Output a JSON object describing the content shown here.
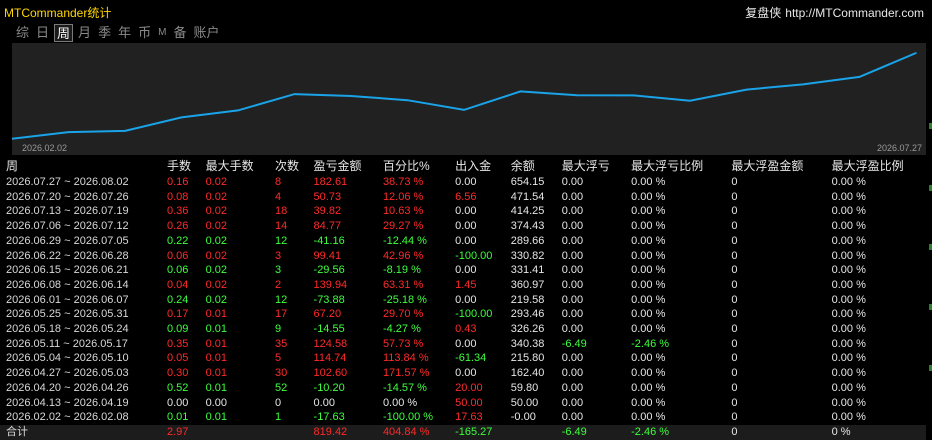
{
  "header": {
    "title": "MTCommander统计",
    "brand": "复盘侠",
    "url": "http://MTCommander.com"
  },
  "tabs": [
    "综",
    "日",
    "周",
    "月",
    "季",
    "年",
    "币",
    "M",
    "备",
    "账户"
  ],
  "active_tab": "周",
  "chart": {
    "start_date": "2026.02.02",
    "end_date": "2026.07.27",
    "line_color": "#1aa3e8"
  },
  "table": {
    "headers": [
      "周",
      "手数",
      "最大手数",
      "次数",
      "盈亏金额",
      "百分比%",
      "出入金",
      "余额",
      "最大浮亏",
      "最大浮亏比例",
      "最大浮盈金额",
      "最大浮盈比例"
    ],
    "rows": [
      {
        "week": "2026.07.27 ~ 2026.08.02",
        "lots": "0.16",
        "max_lots": "0.02",
        "count": "8",
        "pnl": "182.61",
        "pct": "38.73 %",
        "flow": "0.00",
        "balance": "654.15",
        "max_fl": "0.00",
        "max_fl_pct": "0.00 %",
        "max_fp": "0",
        "max_fp_pct": "0.00 %",
        "tone": "red"
      },
      {
        "week": "2026.07.20 ~ 2026.07.26",
        "lots": "0.08",
        "max_lots": "0.02",
        "count": "4",
        "pnl": "50.73",
        "pct": "12.06 %",
        "flow": "6.56",
        "balance": "471.54",
        "max_fl": "0.00",
        "max_fl_pct": "0.00 %",
        "max_fp": "0",
        "max_fp_pct": "0.00 %",
        "tone": "red"
      },
      {
        "week": "2026.07.13 ~ 2026.07.19",
        "lots": "0.36",
        "max_lots": "0.02",
        "count": "18",
        "pnl": "39.82",
        "pct": "10.63 %",
        "flow": "0.00",
        "balance": "414.25",
        "max_fl": "0.00",
        "max_fl_pct": "0.00 %",
        "max_fp": "0",
        "max_fp_pct": "0.00 %",
        "tone": "red"
      },
      {
        "week": "2026.07.06 ~ 2026.07.12",
        "lots": "0.26",
        "max_lots": "0.02",
        "count": "14",
        "pnl": "84.77",
        "pct": "29.27 %",
        "flow": "0.00",
        "balance": "374.43",
        "max_fl": "0.00",
        "max_fl_pct": "0.00 %",
        "max_fp": "0",
        "max_fp_pct": "0.00 %",
        "tone": "red"
      },
      {
        "week": "2026.06.29 ~ 2026.07.05",
        "lots": "0.22",
        "max_lots": "0.02",
        "count": "12",
        "pnl": "-41.16",
        "pct": "-12.44 %",
        "flow": "0.00",
        "balance": "289.66",
        "max_fl": "0.00",
        "max_fl_pct": "0.00 %",
        "max_fp": "0",
        "max_fp_pct": "0.00 %",
        "tone": "green"
      },
      {
        "week": "2026.06.22 ~ 2026.06.28",
        "lots": "0.06",
        "max_lots": "0.02",
        "count": "3",
        "pnl": "99.41",
        "pct": "42.96 %",
        "flow": "-100.00",
        "balance": "330.82",
        "max_fl": "0.00",
        "max_fl_pct": "0.00 %",
        "max_fp": "0",
        "max_fp_pct": "0.00 %",
        "tone": "red"
      },
      {
        "week": "2026.06.15 ~ 2026.06.21",
        "lots": "0.06",
        "max_lots": "0.02",
        "count": "3",
        "pnl": "-29.56",
        "pct": "-8.19 %",
        "flow": "0.00",
        "balance": "331.41",
        "max_fl": "0.00",
        "max_fl_pct": "0.00 %",
        "max_fp": "0",
        "max_fp_pct": "0.00 %",
        "tone": "green"
      },
      {
        "week": "2026.06.08 ~ 2026.06.14",
        "lots": "0.04",
        "max_lots": "0.02",
        "count": "2",
        "pnl": "139.94",
        "pct": "63.31 %",
        "flow": "1.45",
        "balance": "360.97",
        "max_fl": "0.00",
        "max_fl_pct": "0.00 %",
        "max_fp": "0",
        "max_fp_pct": "0.00 %",
        "tone": "red"
      },
      {
        "week": "2026.06.01 ~ 2026.06.07",
        "lots": "0.24",
        "max_lots": "0.02",
        "count": "12",
        "pnl": "-73.88",
        "pct": "-25.18 %",
        "flow": "0.00",
        "balance": "219.58",
        "max_fl": "0.00",
        "max_fl_pct": "0.00 %",
        "max_fp": "0",
        "max_fp_pct": "0.00 %",
        "tone": "green"
      },
      {
        "week": "2026.05.25 ~ 2026.05.31",
        "lots": "0.17",
        "max_lots": "0.01",
        "count": "17",
        "pnl": "67.20",
        "pct": "29.70 %",
        "flow": "-100.00",
        "balance": "293.46",
        "max_fl": "0.00",
        "max_fl_pct": "0.00 %",
        "max_fp": "0",
        "max_fp_pct": "0.00 %",
        "tone": "red"
      },
      {
        "week": "2026.05.18 ~ 2026.05.24",
        "lots": "0.09",
        "max_lots": "0.01",
        "count": "9",
        "pnl": "-14.55",
        "pct": "-4.27 %",
        "flow": "0.43",
        "balance": "326.26",
        "max_fl": "0.00",
        "max_fl_pct": "0.00 %",
        "max_fp": "0",
        "max_fp_pct": "0.00 %",
        "tone": "green"
      },
      {
        "week": "2026.05.11 ~ 2026.05.17",
        "lots": "0.35",
        "max_lots": "0.01",
        "count": "35",
        "pnl": "124.58",
        "pct": "57.73 %",
        "flow": "0.00",
        "balance": "340.38",
        "max_fl": "-6.49",
        "max_fl_pct": "-2.46 %",
        "max_fp": "0",
        "max_fp_pct": "0.00 %",
        "tone": "red"
      },
      {
        "week": "2026.05.04 ~ 2026.05.10",
        "lots": "0.05",
        "max_lots": "0.01",
        "count": "5",
        "pnl": "114.74",
        "pct": "113.84 %",
        "flow": "-61.34",
        "balance": "215.80",
        "max_fl": "0.00",
        "max_fl_pct": "0.00 %",
        "max_fp": "0",
        "max_fp_pct": "0.00 %",
        "tone": "red"
      },
      {
        "week": "2026.04.27 ~ 2026.05.03",
        "lots": "0.30",
        "max_lots": "0.01",
        "count": "30",
        "pnl": "102.60",
        "pct": "171.57 %",
        "flow": "0.00",
        "balance": "162.40",
        "max_fl": "0.00",
        "max_fl_pct": "0.00 %",
        "max_fp": "0",
        "max_fp_pct": "0.00 %",
        "tone": "red"
      },
      {
        "week": "2026.04.20 ~ 2026.04.26",
        "lots": "0.52",
        "max_lots": "0.01",
        "count": "52",
        "pnl": "-10.20",
        "pct": "-14.57 %",
        "flow": "20.00",
        "balance": "59.80",
        "max_fl": "0.00",
        "max_fl_pct": "0.00 %",
        "max_fp": "0",
        "max_fp_pct": "0.00 %",
        "tone": "green"
      },
      {
        "week": "2026.04.13 ~ 2026.04.19",
        "lots": "0.00",
        "max_lots": "0.00",
        "count": "0",
        "pnl": "0.00",
        "pct": "0.00 %",
        "flow": "50.00",
        "balance": "50.00",
        "max_fl": "0.00",
        "max_fl_pct": "0.00 %",
        "max_fp": "0",
        "max_fp_pct": "0.00 %",
        "tone": "white"
      },
      {
        "week": "2026.02.02 ~ 2026.02.08",
        "lots": "0.01",
        "max_lots": "0.01",
        "count": "1",
        "pnl": "-17.63",
        "pct": "-100.00 %",
        "flow": "17.63",
        "balance": "-0.00",
        "max_fl": "0.00",
        "max_fl_pct": "0.00 %",
        "max_fp": "0",
        "max_fp_pct": "0.00 %",
        "tone": "green"
      }
    ],
    "total": {
      "label": "合计",
      "lots": "2.97",
      "pnl": "819.42",
      "pct": "404.84 %",
      "flow": "-165.27",
      "max_fl": "-6.49",
      "max_fl_pct": "-2.46 %",
      "max_fp": "0",
      "max_fp_pct": "0 %"
    }
  },
  "chart_data": {
    "type": "line",
    "title": "",
    "xlabel": "",
    "ylabel": "",
    "x": [
      "2026.02.02",
      "2026.04.13",
      "2026.04.20",
      "2026.04.27",
      "2026.05.04",
      "2026.05.11",
      "2026.05.18",
      "2026.05.25",
      "2026.06.01",
      "2026.06.08",
      "2026.06.15",
      "2026.06.22",
      "2026.06.29",
      "2026.07.06",
      "2026.07.13",
      "2026.07.20",
      "2026.07.27"
    ],
    "values": [
      0.0,
      50.0,
      59.8,
      162.4,
      215.8,
      340.38,
      326.26,
      293.46,
      219.58,
      360.97,
      331.41,
      330.82,
      289.66,
      374.43,
      414.25,
      471.54,
      654.15
    ],
    "ylim": [
      -17.63,
      654.15
    ],
    "grid": false
  }
}
